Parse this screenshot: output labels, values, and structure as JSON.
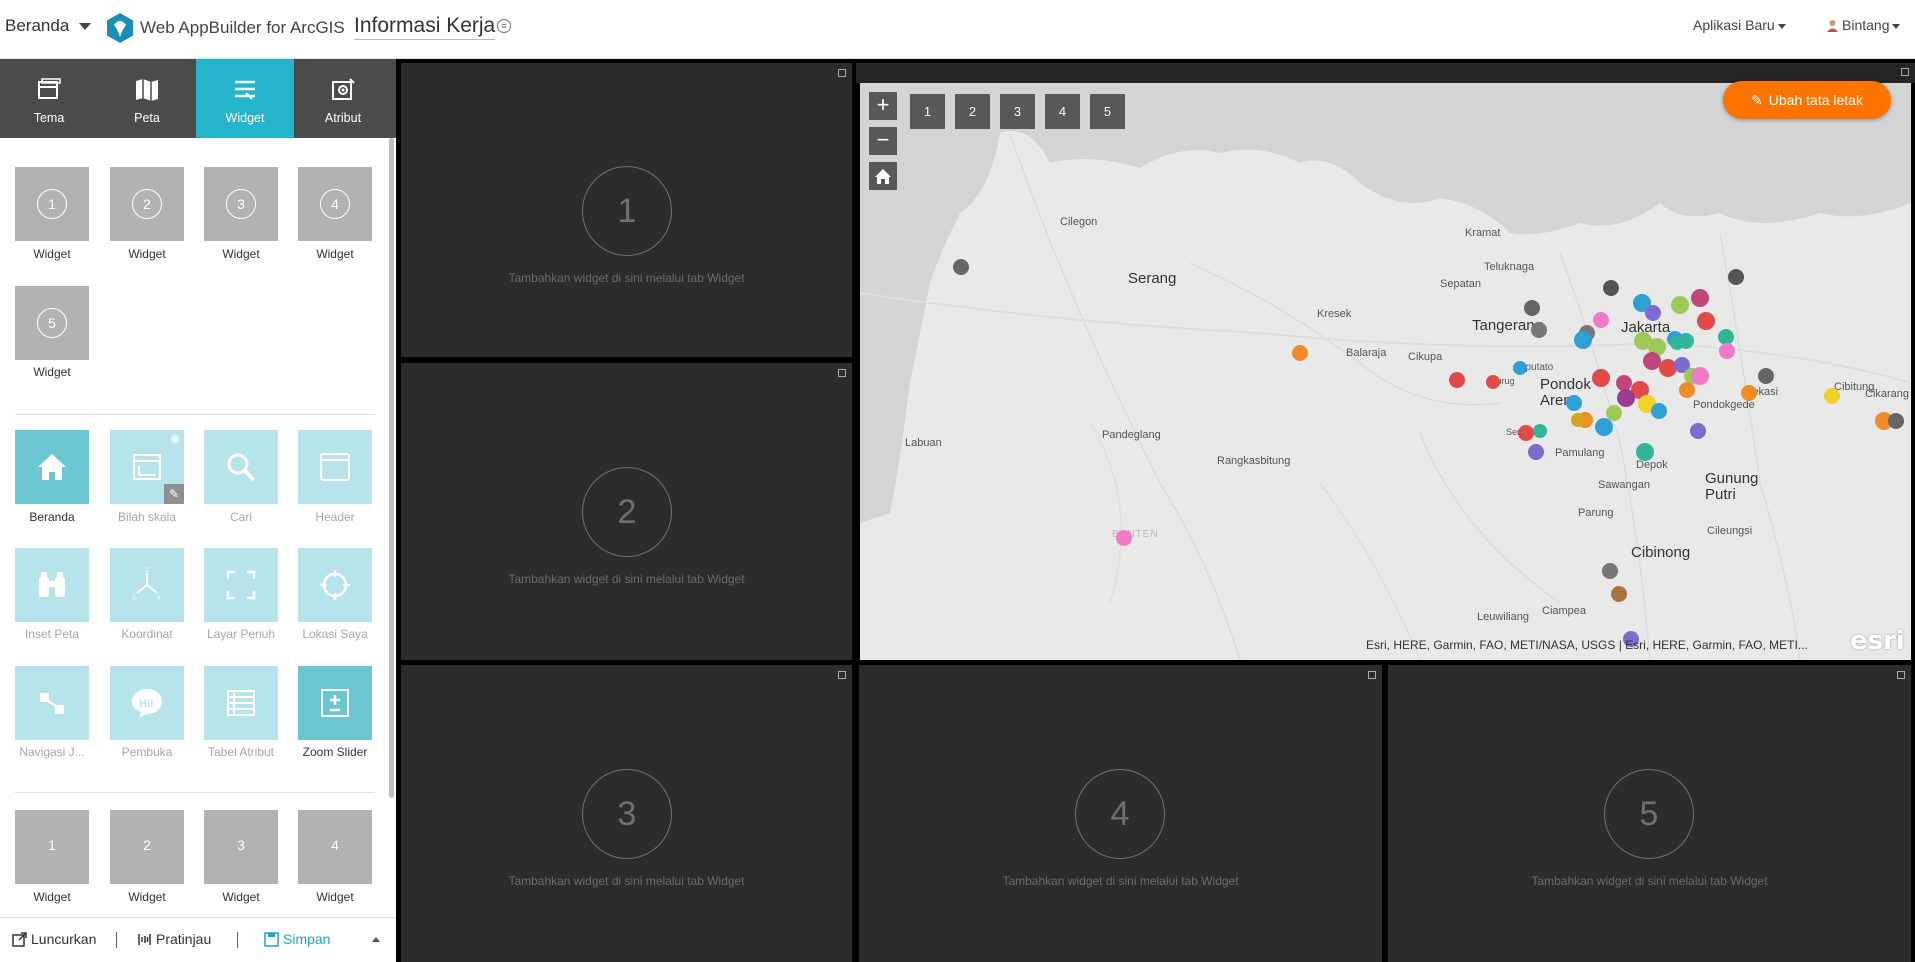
{
  "header": {
    "home_label": "Beranda",
    "app_name": "Web AppBuilder for ArcGIS",
    "project_title": "Informasi Kerja",
    "new_app_label": "Aplikasi Baru",
    "user_label": "Bintang"
  },
  "tabs": [
    {
      "label": "Tema",
      "icon": "theme-icon"
    },
    {
      "label": "Peta",
      "icon": "map-icon"
    },
    {
      "label": "Widget",
      "icon": "widget-icon",
      "active": true
    },
    {
      "label": "Atribut",
      "icon": "attribute-icon"
    }
  ],
  "controller_widgets": [
    {
      "num": "1",
      "label": "Widget"
    },
    {
      "num": "2",
      "label": "Widget"
    },
    {
      "num": "3",
      "label": "Widget"
    },
    {
      "num": "4",
      "label": "Widget"
    },
    {
      "num": "5",
      "label": "Widget"
    }
  ],
  "map_widgets": [
    {
      "label": "Beranda",
      "icon": "home-icon",
      "enabled": true
    },
    {
      "label": "Bilah skala",
      "icon": "scalebar-icon",
      "enabled": false
    },
    {
      "label": "Cari",
      "icon": "search-icon",
      "enabled": false
    },
    {
      "label": "Header",
      "icon": "header-icon",
      "enabled": false
    },
    {
      "label": "Inset Peta",
      "icon": "binoculars-icon",
      "enabled": false
    },
    {
      "label": "Koordinat",
      "icon": "coordinate-icon",
      "enabled": false
    },
    {
      "label": "Layar Penuh",
      "icon": "fullscreen-icon",
      "enabled": false
    },
    {
      "label": "Lokasi Saya",
      "icon": "mylocation-icon",
      "enabled": false
    },
    {
      "label": "Navigasi J...",
      "icon": "navigation-icon",
      "enabled": false
    },
    {
      "label": "Pembuka",
      "icon": "splash-icon",
      "enabled": false
    },
    {
      "label": "Tabel Atribut",
      "icon": "table-icon",
      "enabled": false
    },
    {
      "label": "Zoom Slider",
      "icon": "zoom-slider-icon",
      "enabled": true
    }
  ],
  "panel_widgets": [
    {
      "num": "1",
      "label": "Widget"
    },
    {
      "num": "2",
      "label": "Widget"
    },
    {
      "num": "3",
      "label": "Widget"
    },
    {
      "num": "4",
      "label": "Widget"
    }
  ],
  "bottom_bar": {
    "launch": "Luncurkan",
    "preview": "Pratinjau",
    "save": "Simpan"
  },
  "layout_panels": [
    {
      "num": "1",
      "hint": "Tambahkan widget di sini melalui tab Widget"
    },
    {
      "num": "2",
      "hint": "Tambahkan widget di sini melalui tab Widget"
    },
    {
      "num": "3",
      "hint": "Tambahkan widget di sini melalui tab Widget"
    },
    {
      "num": "4",
      "hint": "Tambahkan widget di sini melalui tab Widget"
    },
    {
      "num": "5",
      "hint": "Tambahkan widget di sini melalui tab Widget"
    }
  ],
  "map": {
    "zoom_in": "+",
    "zoom_out": "−",
    "slots": [
      "1",
      "2",
      "3",
      "4",
      "5"
    ],
    "edit_layout": "Ubah tata letak",
    "attribution": "Esri, HERE, Garmin, FAO, METI/NASA, USGS | Esri, HERE, Garmin, FAO, METI...",
    "logo_text": "esri",
    "cities": [
      "Cilegon",
      "Serang",
      "Kresek",
      "Balaraja",
      "Cikupa",
      "Tangerang",
      "Jakarta",
      "Teluknaga",
      "Sepatan",
      "Kramat",
      "Labuan",
      "Pandeglang",
      "Rangkasbitung",
      "Pondok Aren",
      "Pamulang",
      "Depok",
      "Sawangan",
      "Parung",
      "Cibinong",
      "Gunung Putri",
      "Cileungsi",
      "Ciampea",
      "Leuwiliang",
      "Bekasi",
      "Cibitung",
      "Cikarang",
      "Pondokgede",
      "Serpong",
      "Ciputato",
      "Curug",
      "BANTEN"
    ],
    "accent": "#ff7300"
  },
  "colors": {
    "active_tab": "#24b5cc",
    "tab_bar": "#4b4b4b",
    "save": "#24a3c9"
  }
}
